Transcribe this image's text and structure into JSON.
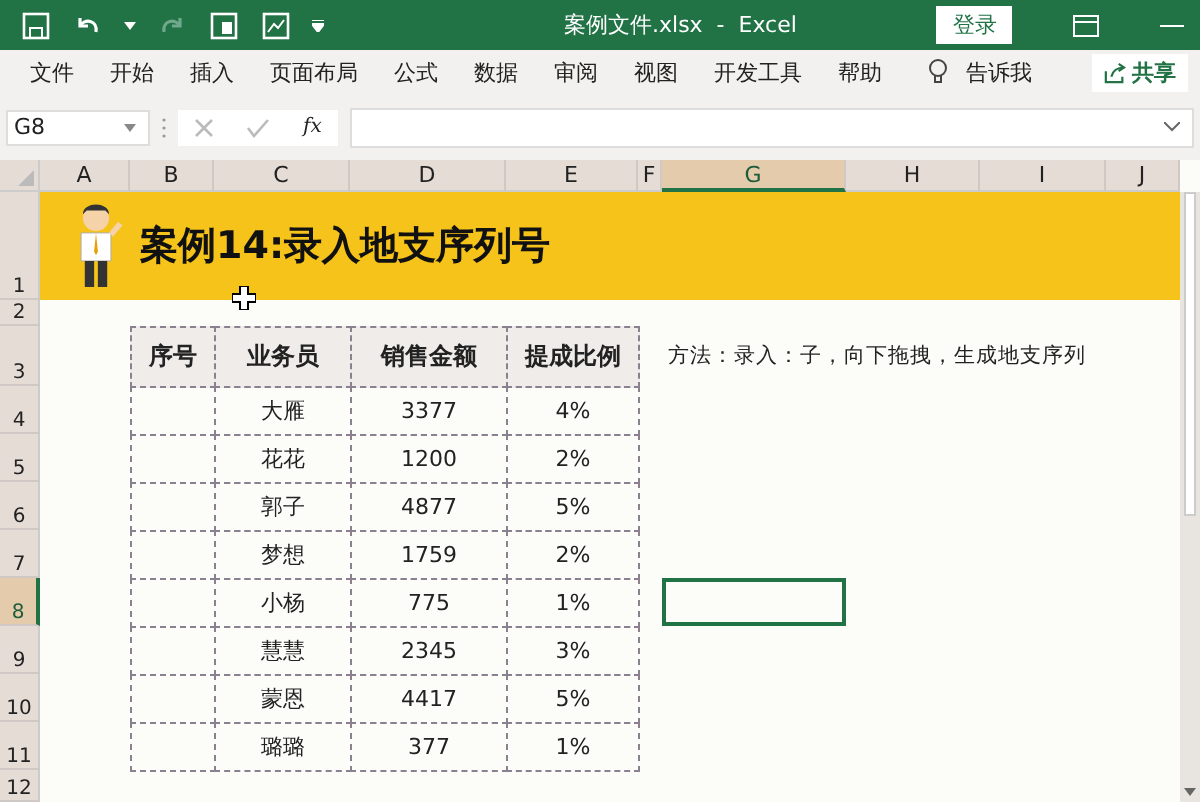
{
  "window": {
    "title": "案例文件.xlsx  -  Excel",
    "login_button": "登录"
  },
  "ribbon": {
    "tabs": [
      "文件",
      "开始",
      "插入",
      "页面布局",
      "公式",
      "数据",
      "审阅",
      "视图",
      "开发工具",
      "帮助"
    ],
    "tell_me": "告诉我",
    "share": "共享"
  },
  "formula_bar": {
    "name_box": "G8",
    "fx": "fx"
  },
  "columns": [
    {
      "label": "A",
      "selected": false
    },
    {
      "label": "B",
      "selected": false
    },
    {
      "label": "C",
      "selected": false
    },
    {
      "label": "D",
      "selected": false
    },
    {
      "label": "E",
      "selected": false
    },
    {
      "label": "F",
      "selected": false
    },
    {
      "label": "G",
      "selected": true
    },
    {
      "label": "H",
      "selected": false
    },
    {
      "label": "I",
      "selected": false
    },
    {
      "label": "J",
      "selected": false
    }
  ],
  "rows": [
    {
      "label": "1",
      "selected": false
    },
    {
      "label": "2",
      "selected": false
    },
    {
      "label": "3",
      "selected": false
    },
    {
      "label": "4",
      "selected": false
    },
    {
      "label": "5",
      "selected": false
    },
    {
      "label": "6",
      "selected": false
    },
    {
      "label": "7",
      "selected": false
    },
    {
      "label": "8",
      "selected": true
    },
    {
      "label": "9",
      "selected": false
    },
    {
      "label": "10",
      "selected": false
    },
    {
      "label": "11",
      "selected": false
    },
    {
      "label": "12",
      "selected": false
    }
  ],
  "banner": {
    "title": "案例14:录入地支序列号"
  },
  "table": {
    "columns": [
      "序号",
      "业务员",
      "销售金额",
      "提成比例"
    ],
    "rows": [
      {
        "name": "大雁",
        "amount": "3377",
        "rate": "4%"
      },
      {
        "name": "花花",
        "amount": "1200",
        "rate": "2%"
      },
      {
        "name": "郭子",
        "amount": "4877",
        "rate": "5%"
      },
      {
        "name": "梦想",
        "amount": "1759",
        "rate": "2%"
      },
      {
        "name": "小杨",
        "amount": "775",
        "rate": "1%"
      },
      {
        "name": "慧慧",
        "amount": "2345",
        "rate": "3%"
      },
      {
        "name": "蒙恩",
        "amount": "4417",
        "rate": "5%"
      },
      {
        "name": "璐璐",
        "amount": "377",
        "rate": "1%"
      }
    ]
  },
  "note": "方法：录入：子，向下拖拽，生成地支序列"
}
